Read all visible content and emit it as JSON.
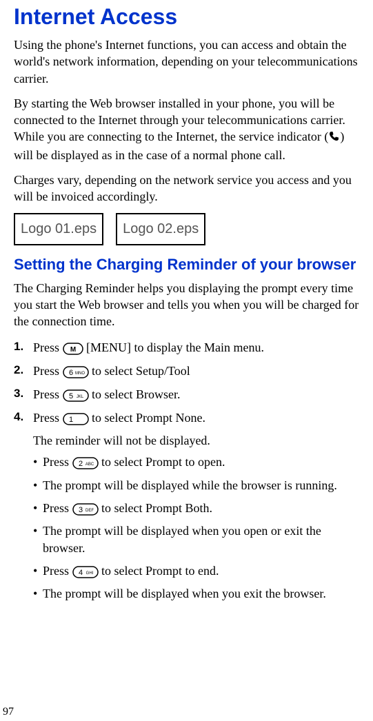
{
  "page": {
    "number": "97"
  },
  "title": "Internet Access",
  "paragraphs": {
    "p1": "Using the phone's Internet functions, you can access and obtain the world's network information, depending on your telecommunications carrier.",
    "p2_a": "By starting the Web browser installed in your phone, you will be connected to the Internet through your telecommunications carrier. While you are connecting to the Internet, the service indicator (",
    "p2_b": ") will be displayed as in the case of a normal phone call.",
    "p3": "Charges vary, depending on the network service you access and you will be invoiced accordingly."
  },
  "logos": {
    "logo1": "Logo 01.eps",
    "logo2": "Logo 02.eps"
  },
  "subheading": "Setting the Charging Reminder of your browser",
  "subpara": "The Charging Reminder helps you displaying the prompt every time you start the Web browser and tells you when you will be charged for the connection time.",
  "steps": {
    "s1_num": "1.",
    "s1_a": "Press ",
    "s1_b": " [MENU] to display the Main menu.",
    "s2_num": "2.",
    "s2_a": "Press ",
    "s2_b": " to select Setup/Tool",
    "s3_num": "3.",
    "s3_a": "Press ",
    "s3_b": " to select Browser.",
    "s4_num": "4.",
    "s4_a": "Press ",
    "s4_b": " to select Prompt None.",
    "s4_sub": "The reminder will not be displayed."
  },
  "bullets": {
    "b1_a": "Press ",
    "b1_b": " to select Prompt to open.",
    "b2": "The prompt will be displayed while the browser is running.",
    "b3_a": "Press ",
    "b3_b": " to select Prompt Both.",
    "b4": "The prompt will be displayed when you open or exit the browser.",
    "b5_a": "Press ",
    "b5_b": " to select Prompt to end.",
    "b6": "The prompt will be displayed when you exit the browser."
  },
  "keys": {
    "m": "M",
    "k1": "1",
    "k2": "2",
    "k3": "3",
    "k4": "4",
    "k5": "5",
    "k6": "6",
    "sub2": "ABC",
    "sub3": "DEF",
    "sub4": "GHI",
    "sub5": "JKL",
    "sub6": "MNO"
  }
}
